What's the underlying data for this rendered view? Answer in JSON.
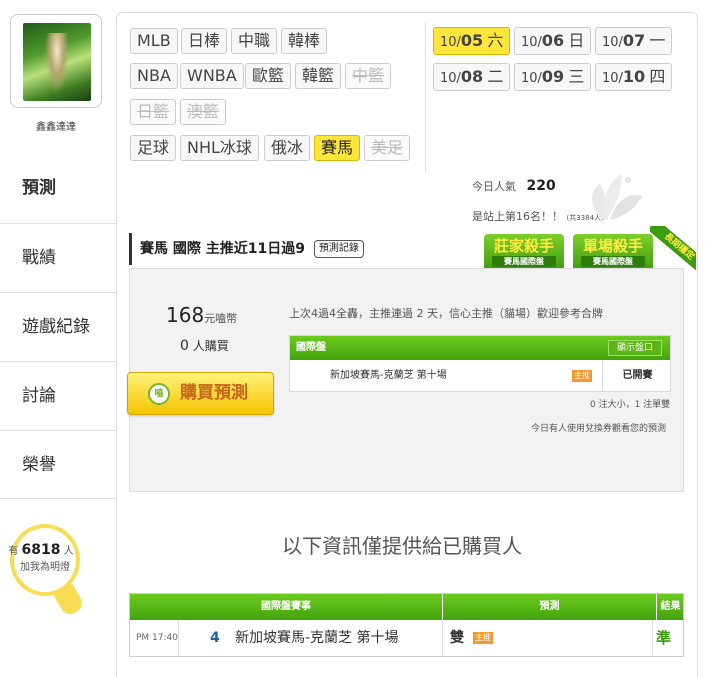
{
  "user": {
    "name": "鑫鑫達達"
  },
  "nav": [
    "預測",
    "戰績",
    "遊戲紀錄",
    "討論",
    "榮譽"
  ],
  "fans": {
    "prefix": "有",
    "count": "6818",
    "suffix": "人",
    "line2": "加我為明燈"
  },
  "sports": [
    {
      "label": "MLB",
      "state": "normal"
    },
    {
      "label": "日棒",
      "state": "normal"
    },
    {
      "label": "中職",
      "state": "normal"
    },
    {
      "label": "韓棒",
      "state": "normal"
    },
    {
      "label": "NBA",
      "state": "normal"
    },
    {
      "label": "WNBA",
      "state": "normal"
    },
    {
      "label": "歐籃",
      "state": "normal"
    },
    {
      "label": "韓籃",
      "state": "normal"
    },
    {
      "label": "中籃",
      "state": "disabled"
    },
    {
      "label": "日籃",
      "state": "disabled"
    },
    {
      "label": "澳籃",
      "state": "disabled"
    },
    {
      "label": "足球",
      "state": "normal"
    },
    {
      "label": "NHL冰球",
      "state": "normal"
    },
    {
      "label": "俄冰",
      "state": "normal"
    },
    {
      "label": "賽馬",
      "state": "selected"
    },
    {
      "label": "美足",
      "state": "disabled"
    }
  ],
  "dates": [
    {
      "md": "10/",
      "d": "05",
      "wd": "六",
      "selected": true
    },
    {
      "md": "10/",
      "d": "06",
      "wd": "日"
    },
    {
      "md": "10/",
      "d": "07",
      "wd": "一"
    },
    {
      "md": "10/",
      "d": "08",
      "wd": "二"
    },
    {
      "md": "10/",
      "d": "09",
      "wd": "三"
    },
    {
      "md": "10/",
      "d": "10",
      "wd": "四"
    }
  ],
  "popularity": {
    "label": "今日人氣",
    "value": "220",
    "rank_text": "是站上第16名！！",
    "total": "(共3384人)"
  },
  "header": {
    "title": "賽馬 國際 主推近11日過9",
    "record_btn": "預測記錄"
  },
  "badges": [
    {
      "title": "莊家殺手",
      "sub": "賽馬國際盤"
    },
    {
      "title": "單場殺手",
      "sub": "賽馬國際盤"
    }
  ],
  "ribbon": "長期穩定",
  "price": {
    "value": "168",
    "unit": "元嗑幣"
  },
  "buyers": {
    "count": "0",
    "label": "人購買"
  },
  "buy_button": "購買預測",
  "coin_label": "嗑",
  "message": "上次4過4全轟，主推連過 2 天，信心主推（貓場）歡迎參考合牌",
  "game_table": {
    "title": "國際盤",
    "show_btn": "顯示盤口",
    "row": {
      "name": "新加坡賽馬-克蘭芝 第十場",
      "tag": "主推",
      "status": "已開賽"
    }
  },
  "note1": "0 注大小，1 注單雙",
  "note2": "今日有人使用兌換券觀看您的預測",
  "info": "以下資訊僅提供給已購買人",
  "bottom_table": {
    "headers": [
      "國際盤賽事",
      "預測",
      "結果"
    ],
    "row": {
      "time": "PM 17:40",
      "num": "4",
      "race": "新加坡賽馬-克蘭芝 第十場",
      "pick": "雙",
      "tag": "主推",
      "result": "準"
    }
  }
}
